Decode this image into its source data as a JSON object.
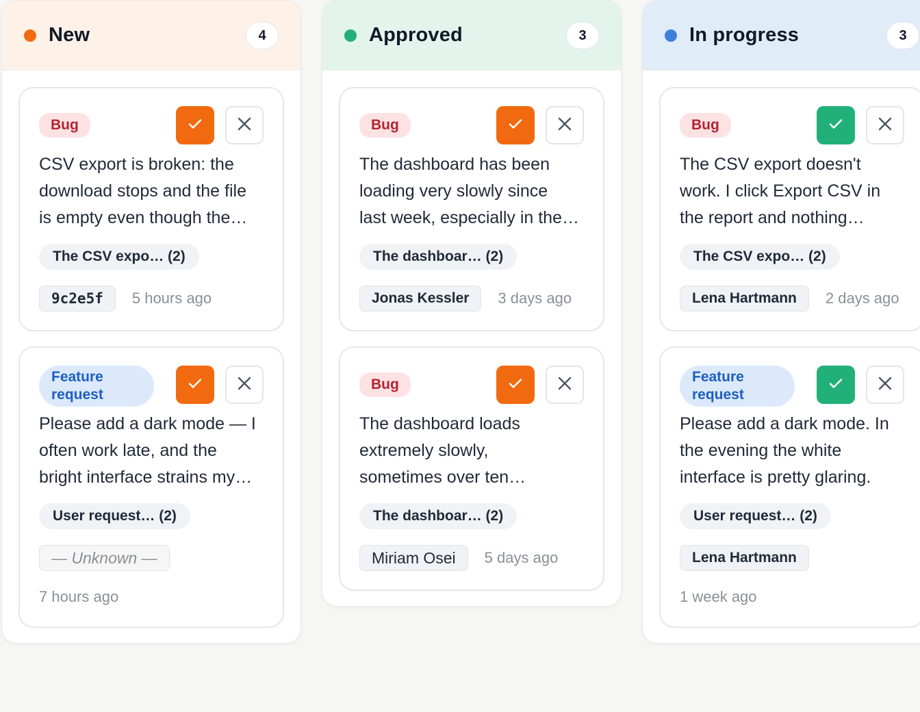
{
  "colors": {
    "orange": "#f26a10",
    "green": "#22b07a",
    "blue": "#3f7fdc"
  },
  "columns": [
    {
      "title": "New",
      "count": "4",
      "header_bg": "#fdf1e8",
      "dot": "#f26a10",
      "cards": [
        {
          "tag": "Bug",
          "tag_type": "bug",
          "ok_color": "#f26a10",
          "lines": [
            "CSV export is broken: the",
            "download stops and the file",
            "is empty even though the…"
          ],
          "chip": "The CSV expo… (2)",
          "who": "9c2e5f",
          "who_style": "mono",
          "ago": "5 hours ago"
        },
        {
          "tag": "Feature request",
          "tag_type": "feature",
          "ok_color": "#f26a10",
          "lines": [
            "Please add a dark mode — I",
            "often work late, and the",
            "bright interface strains my…"
          ],
          "chip": "User request… (2)",
          "who": "— Unknown —",
          "who_style": "unknown",
          "ago": "7 hours ago",
          "ago_below": true
        }
      ]
    },
    {
      "title": "Approved",
      "count": "3",
      "header_bg": "#e2f4ec",
      "dot": "#22b07a",
      "cards": [
        {
          "tag": "Bug",
          "tag_type": "bug",
          "ok_color": "#f26a10",
          "lines": [
            "The dashboard has been",
            "loading very slowly since",
            "last week, especially in the…"
          ],
          "chip": "The dashboar… (2)",
          "who": "Jonas Kessler",
          "who_style": "bold",
          "ago": "3 days ago"
        },
        {
          "tag": "Bug",
          "tag_type": "bug",
          "ok_color": "#f26a10",
          "lines": [
            "The dashboard loads",
            "extremely slowly,",
            "sometimes over ten…"
          ],
          "chip": "The dashboar… (2)",
          "who": "Miriam Osei",
          "who_style": "plain",
          "ago": "5 days ago"
        }
      ]
    },
    {
      "title": "In progress",
      "count": "3",
      "header_bg": "#e1ecf9",
      "dot": "#3f7fdc",
      "cards": [
        {
          "tag": "Bug",
          "tag_type": "bug",
          "ok_color": "#22b07a",
          "lines": [
            "The CSV export doesn't",
            "work. I click Export CSV in",
            "the report and nothing…"
          ],
          "chip": "The CSV expo… (2)",
          "who": "Lena Hartmann",
          "who_style": "bold",
          "ago": "2 days ago"
        },
        {
          "tag": "Feature request",
          "tag_type": "feature",
          "ok_color": "#22b07a",
          "lines": [
            "Please add a dark mode. In",
            "the evening the white",
            "interface is pretty glaring."
          ],
          "chip": "User request… (2)",
          "who": "Lena Hartmann",
          "who_style": "bold",
          "ago": "1 week ago",
          "ago_below": true
        }
      ]
    }
  ]
}
